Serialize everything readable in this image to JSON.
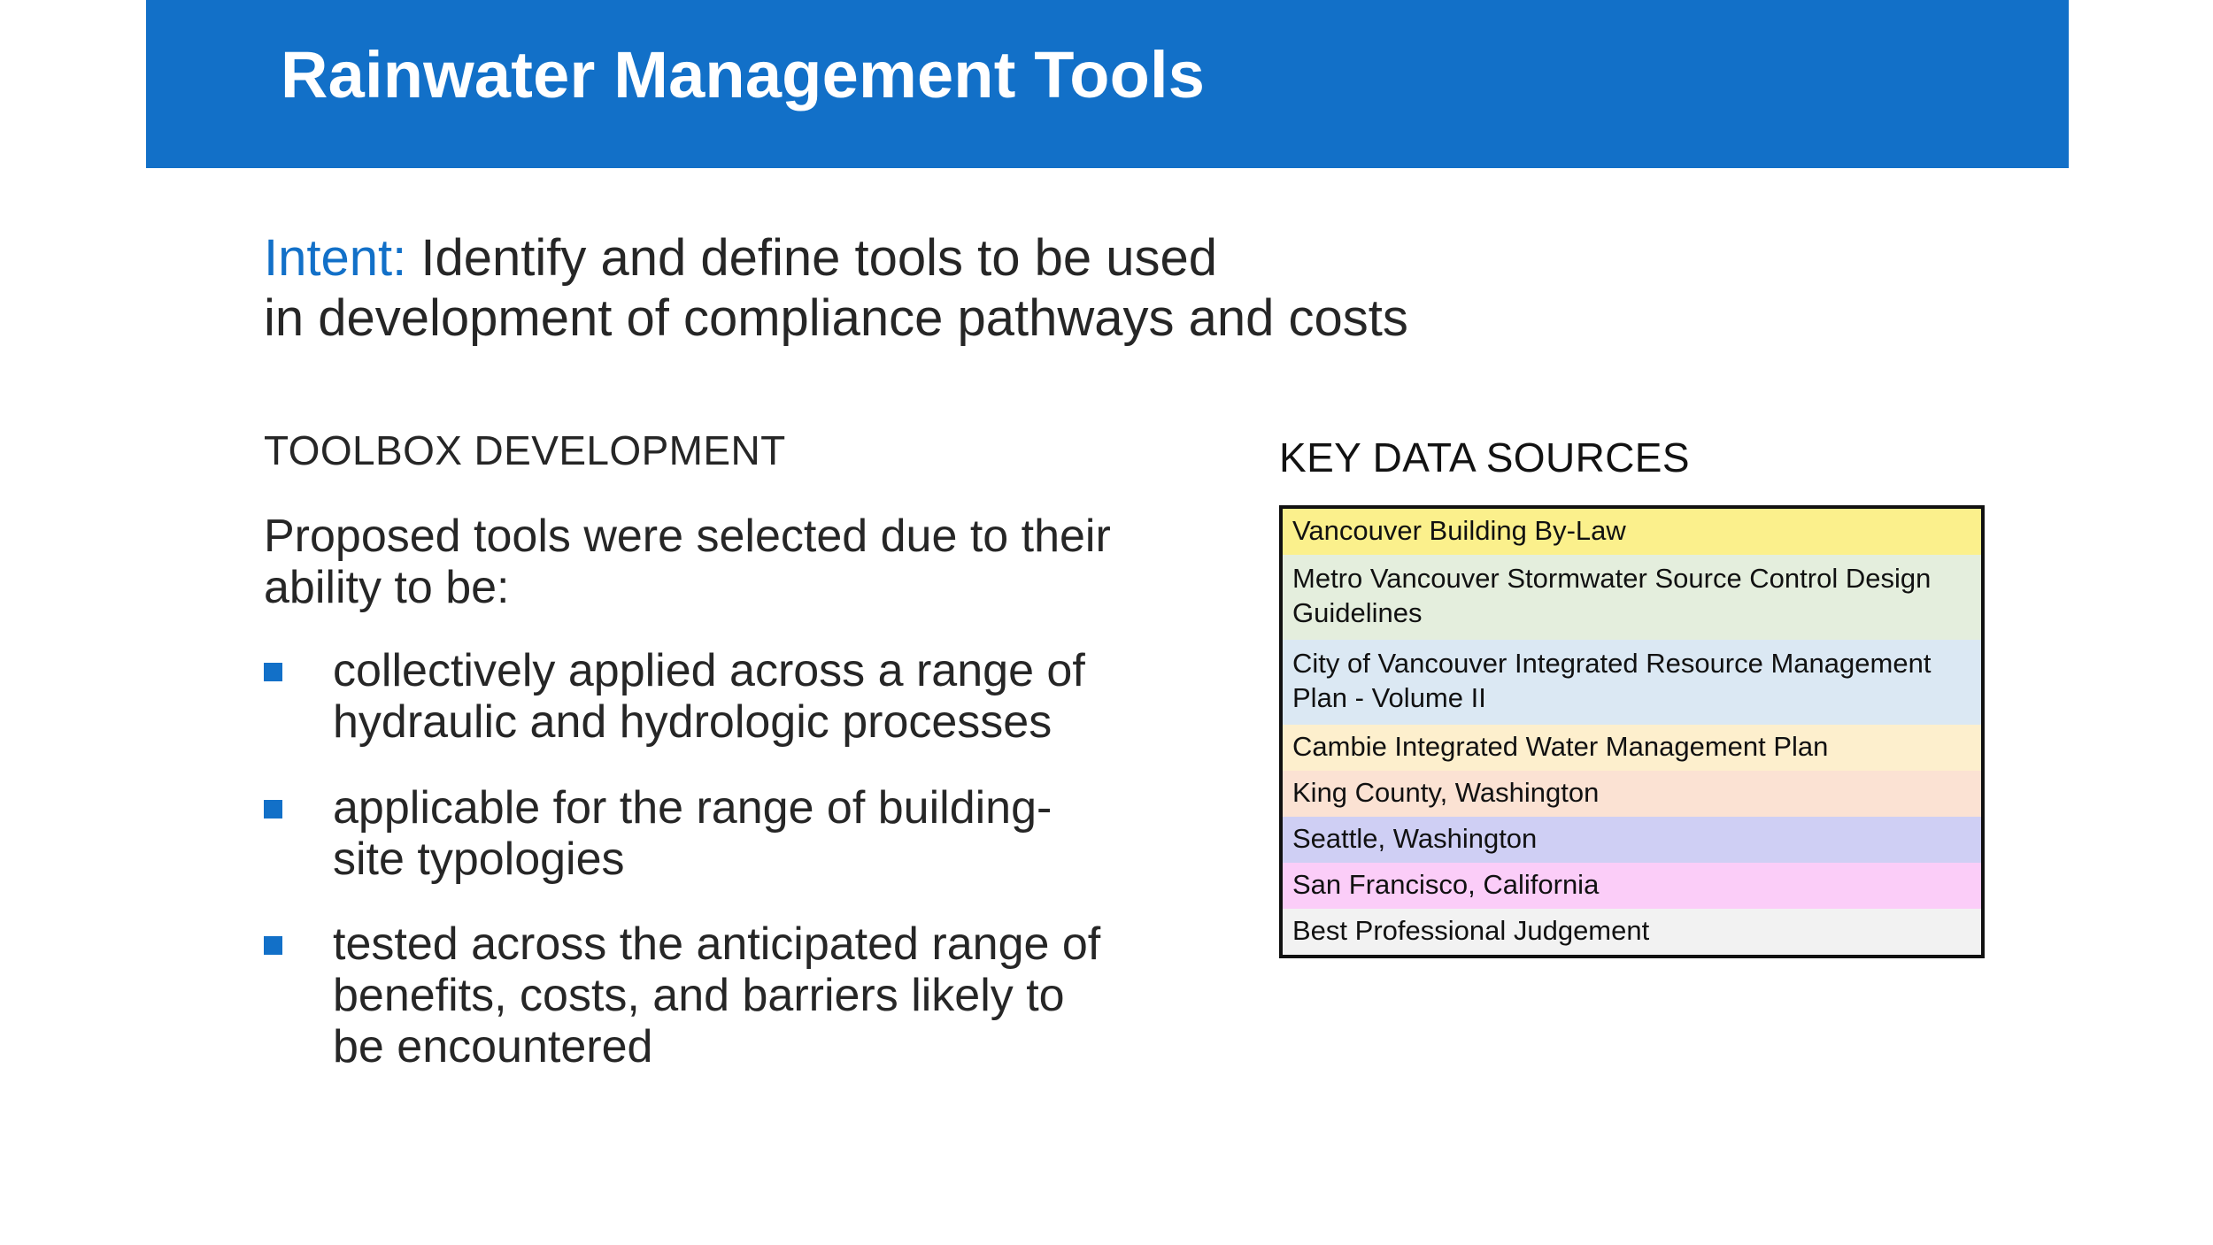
{
  "slide": {
    "title": "Rainwater Management Tools",
    "banner_color": "#1270c8"
  },
  "intent": {
    "label": "Intent:",
    "line1": " Identify and define tools to be used",
    "line2": "in development of compliance pathways and costs",
    "label_color": "#1270c8"
  },
  "left_column": {
    "heading": "TOOLBOX DEVELOPMENT",
    "intro": "Proposed tools were selected due to their ability to be:",
    "bullet_color": "#1270c8",
    "bullets": [
      {
        "text": "collectively applied across a range of hydraulic and hydrologic processes"
      },
      {
        "text": "applicable for the range of building-site typologies"
      },
      {
        "text": "tested across the anticipated range of benefits, costs, and barriers likely to be encountered"
      }
    ]
  },
  "right_column": {
    "heading": "KEY DATA SOURCES",
    "table": {
      "border_color": "#111111",
      "rows": [
        {
          "label": "Vancouver Building By-Law",
          "color": "#fbf08c",
          "lines": 1
        },
        {
          "label": "Metro Vancouver Stormwater Source Control Design Guidelines",
          "color": "#e4eedd",
          "lines": 2
        },
        {
          "label": "City of Vancouver Integrated Resource Management Plan - Volume II",
          "color": "#dbe8f3",
          "lines": 2
        },
        {
          "label": "Cambie Integrated Water Management Plan",
          "color": "#fdefcd",
          "lines": 1
        },
        {
          "label": "King County, Washington",
          "color": "#fbe2d3",
          "lines": 1
        },
        {
          "label": "Seattle, Washington",
          "color": "#cfcff4",
          "lines": 1
        },
        {
          "label": "San Francisco, California",
          "color": "#fbcdf8",
          "lines": 1
        },
        {
          "label": "Best Professional Judgement",
          "color": "#f2f2f2",
          "lines": 1
        }
      ]
    }
  }
}
